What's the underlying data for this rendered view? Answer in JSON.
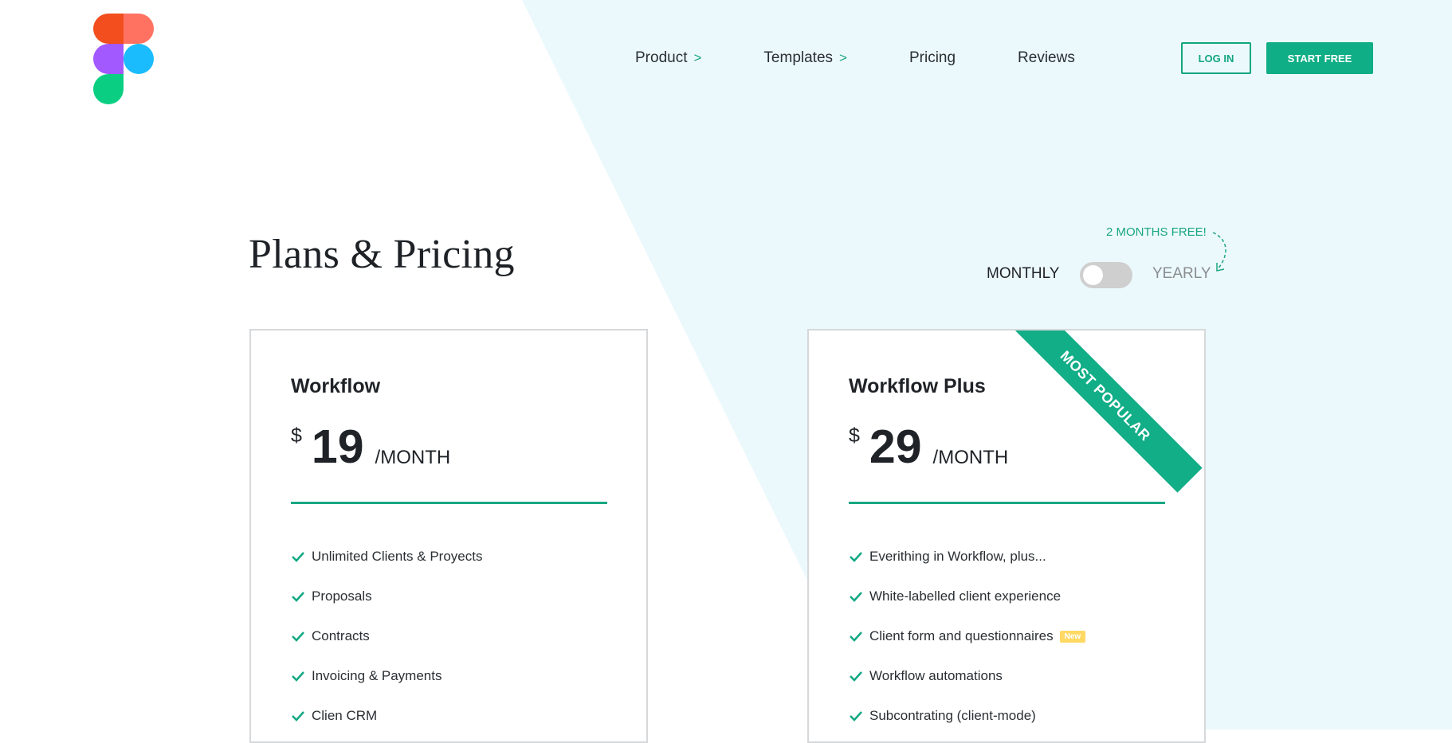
{
  "colors": {
    "accent": "#0fae86",
    "accent_text": "#1aa67d",
    "hero_bg": "#ecf9fc",
    "badge_new": "#ffd964"
  },
  "logo": {
    "name": "figma-logo"
  },
  "nav": {
    "items": [
      {
        "label": "Product",
        "arrow": ">"
      },
      {
        "label": "Templates",
        "arrow": ">"
      },
      {
        "label": "Pricing"
      },
      {
        "label": "Reviews"
      }
    ],
    "login_label": "LOG IN",
    "start_label": "START FREE"
  },
  "page": {
    "title": "Plans & Pricing"
  },
  "billing": {
    "promo": "2 MONTHS FREE!",
    "monthly_label": "MONTHLY",
    "yearly_label": "YEARLY",
    "yearly_selected": false
  },
  "plans": [
    {
      "name": "Workflow",
      "currency": "$",
      "amount": "19",
      "period": "/MONTH",
      "features": [
        "Unlimited Clients & Proyects",
        "Proposals",
        "Contracts",
        "Invoicing & Payments",
        "Clien CRM"
      ]
    },
    {
      "name": "Workflow Plus",
      "currency": "$",
      "amount": "29",
      "period": "/MONTH",
      "ribbon": "MOST POPULAR",
      "features": [
        "Everithing in Workflow, plus...",
        "White-labelled client experience",
        "Client form and questionnaires",
        "Workflow automations",
        "Subcontrating (client-mode)"
      ],
      "badge_new": "New"
    }
  ]
}
